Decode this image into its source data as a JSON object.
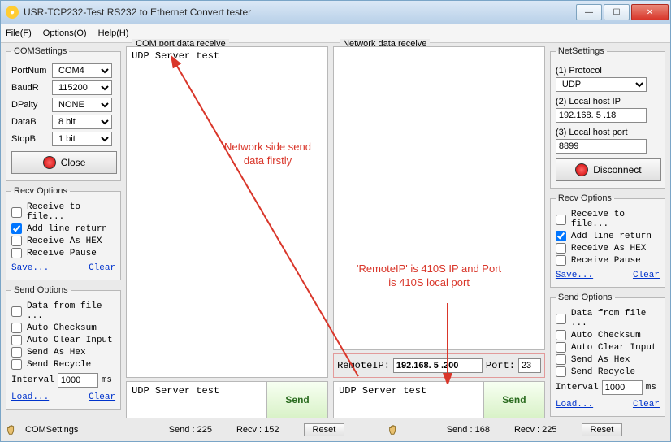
{
  "title": "USR-TCP232-Test  RS232 to Ethernet Convert tester",
  "menu": {
    "file": "File(F)",
    "options": "Options(O)",
    "help": "Help(H)"
  },
  "comSettings": {
    "legend": "COMSettings",
    "portNumLabel": "PortNum",
    "portNum": "COM4",
    "baudLabel": "BaudR",
    "baud": "115200",
    "parityLabel": "DPaity",
    "parity": "NONE",
    "dataLabel": "DataB",
    "data": "8 bit",
    "stopLabel": "StopB",
    "stop": "1 bit",
    "actionLabel": "Close"
  },
  "recvOptions": {
    "legend": "Recv Options",
    "toFile": "Receive to file...",
    "addLine": "Add line return",
    "asHex": "Receive As HEX",
    "pause": "Receive Pause",
    "save": "Save...",
    "clear": "Clear"
  },
  "sendOptions": {
    "legend": "Send Options",
    "fromFile": "Data from file ...",
    "autoChecksum": "Auto Checksum",
    "autoClear": "Auto Clear Input",
    "asHex": "Send As Hex",
    "recycle": "Send Recycle",
    "intervalLabel": "Interval",
    "intervalVal": "1000",
    "intervalUnit": "ms",
    "load": "Load...",
    "clear": "Clear"
  },
  "comPane": {
    "title": "COM port data receive",
    "content": "UDP Server test",
    "sendText": "UDP Server test",
    "send": "Send"
  },
  "netPane": {
    "title": "Network data receive",
    "content": "",
    "remoteLabel": "RemoteIP:",
    "remoteIP": "192.168. 5 .200",
    "portLabel": "Port:",
    "port": "23",
    "sendText": "UDP Server test",
    "send": "Send"
  },
  "netSettings": {
    "legend": "NetSettings",
    "protoLabel": "(1) Protocol",
    "proto": "UDP",
    "ipLabel": "(2) Local host IP",
    "ip": "192.168. 5 .18",
    "portLabel": "(3) Local host port",
    "port": "8899",
    "actionLabel": "Disconnect"
  },
  "status": {
    "left": {
      "label": "COMSettings",
      "send": "Send : 225",
      "recv": "Recv : 152",
      "reset": "Reset"
    },
    "right": {
      "label": "",
      "send": "Send : 168",
      "recv": "Recv : 225",
      "reset": "Reset"
    }
  },
  "annotations": {
    "a1": "Network side send\ndata firstly",
    "a2": "'RemoteIP' is 410S IP and Port\nis 410S local port"
  }
}
